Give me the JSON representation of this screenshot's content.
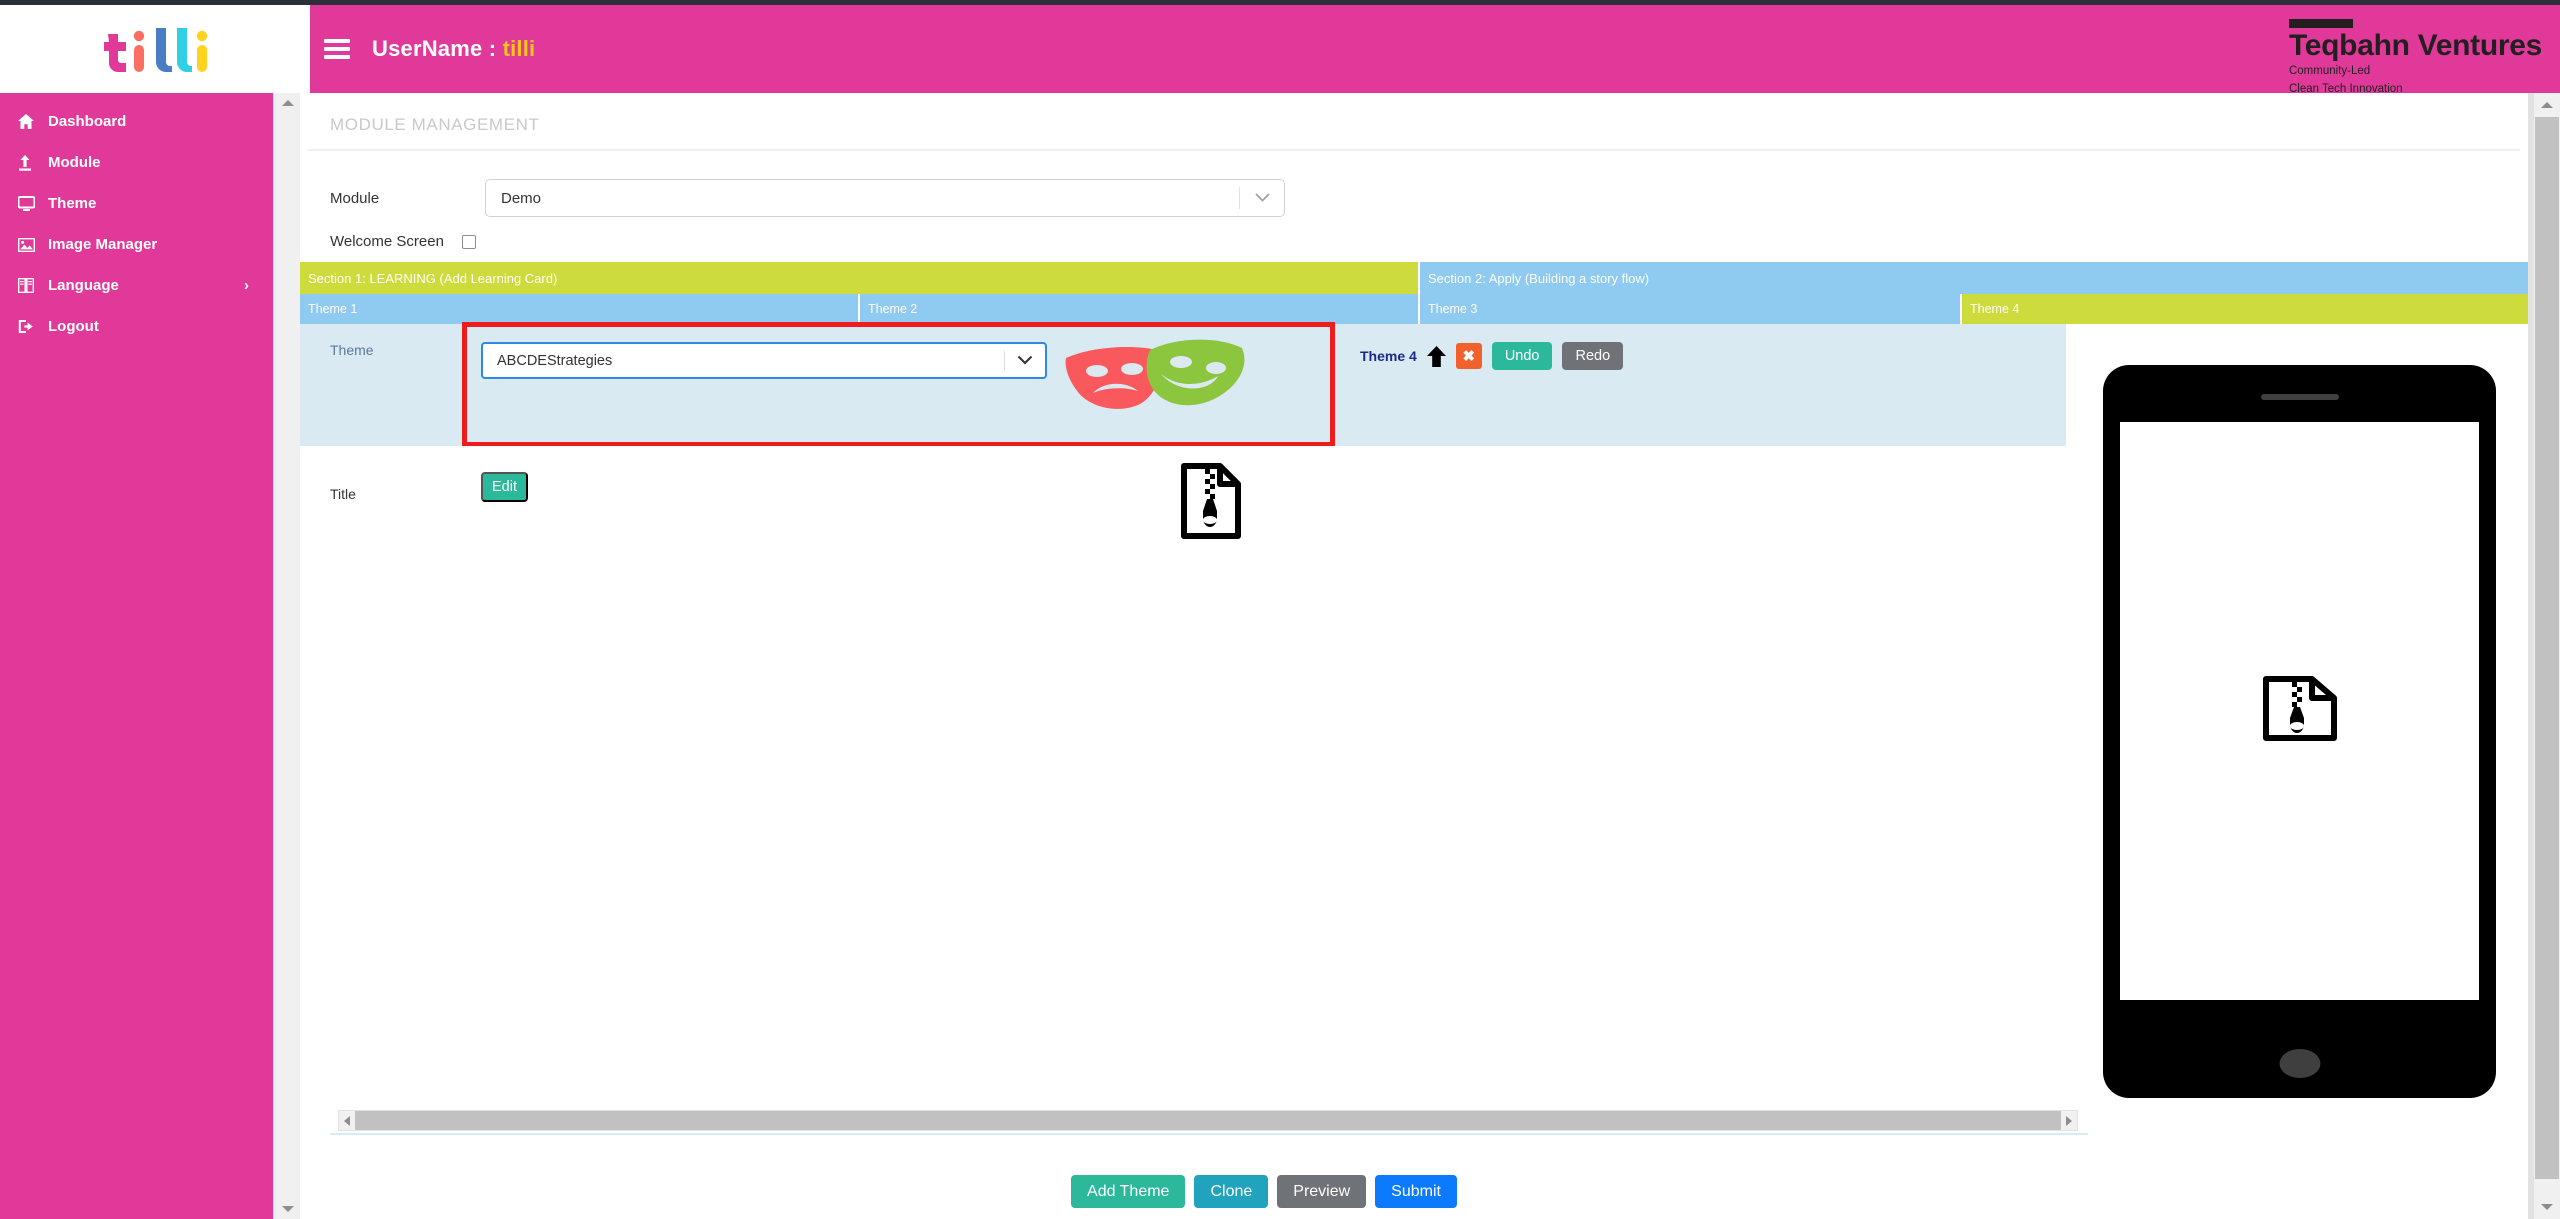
{
  "header": {
    "menu_icon": "hamburger-icon",
    "username_label": "UserName :",
    "username_value": "tilli",
    "brand_logo_text": "tilli"
  },
  "corporate_logo": {
    "name": "Teqbahn Ventures",
    "tagline_line1": "Community-Led",
    "tagline_line2": "Clean Tech Innovation"
  },
  "sidebar": {
    "items": [
      {
        "label": "Dashboard",
        "icon": "home-icon",
        "has_caret": false
      },
      {
        "label": "Module",
        "icon": "upload-icon",
        "has_caret": false
      },
      {
        "label": "Theme",
        "icon": "monitor-icon",
        "has_caret": false
      },
      {
        "label": "Image Manager",
        "icon": "image-icon",
        "has_caret": false
      },
      {
        "label": "Language",
        "icon": "book-icon",
        "has_caret": true,
        "caret": "›"
      },
      {
        "label": "Logout",
        "icon": "logout-icon",
        "has_caret": false
      }
    ]
  },
  "main": {
    "page_title": "MODULE MANAGEMENT",
    "module_field": {
      "label": "Module",
      "value": "Demo",
      "chevron": "chevron-down-icon"
    },
    "welcome_screen": {
      "label": "Welcome Screen",
      "checked": false
    },
    "sections": [
      {
        "label": "Section 1: LEARNING (Add Learning Card)",
        "color": "#cddb3c"
      },
      {
        "label": "Section 2: Apply (Building a story flow)",
        "color": "#8fcaf0"
      }
    ],
    "themes_header": [
      {
        "label": "Theme 1",
        "color": "#8fcaf0",
        "active": false
      },
      {
        "label": "Theme 2",
        "color": "#8fcaf0",
        "active": false
      },
      {
        "label": "Theme 3",
        "color": "#8fcaf0",
        "active": false
      },
      {
        "label": "Theme 4",
        "color": "#cddb3c",
        "active": true
      }
    ],
    "theme_editor": {
      "label": "Theme",
      "selected_theme": "ABCDEStrategies",
      "chevron": "chevron-down-icon",
      "preview_icon": "theater-masks-icon",
      "highlight_border_color": "#ee1c1c",
      "current_theme_label": "Theme 4",
      "move_up_icon": "arrow-up-icon",
      "delete_label": "✖",
      "undo_label": "Undo",
      "redo_label": "Redo"
    },
    "title_row": {
      "label": "Title",
      "edit_label": "Edit",
      "asset_icon": "zip-file-icon"
    },
    "preview_device": {
      "screen_icon": "zip-file-icon"
    }
  },
  "footer_actions": [
    {
      "label": "Add Theme",
      "color": "#2cb89b"
    },
    {
      "label": "Clone",
      "color": "#22a3bd"
    },
    {
      "label": "Preview",
      "color": "#6f7277"
    },
    {
      "label": "Submit",
      "color": "#0b7afc"
    }
  ],
  "scrollbars": {
    "horizontal_left_arrow": "triangle-left-icon",
    "horizontal_right_arrow": "triangle-right-icon",
    "vertical_up_arrow": "triangle-up-icon",
    "vertical_down_arrow": "triangle-down-icon"
  }
}
